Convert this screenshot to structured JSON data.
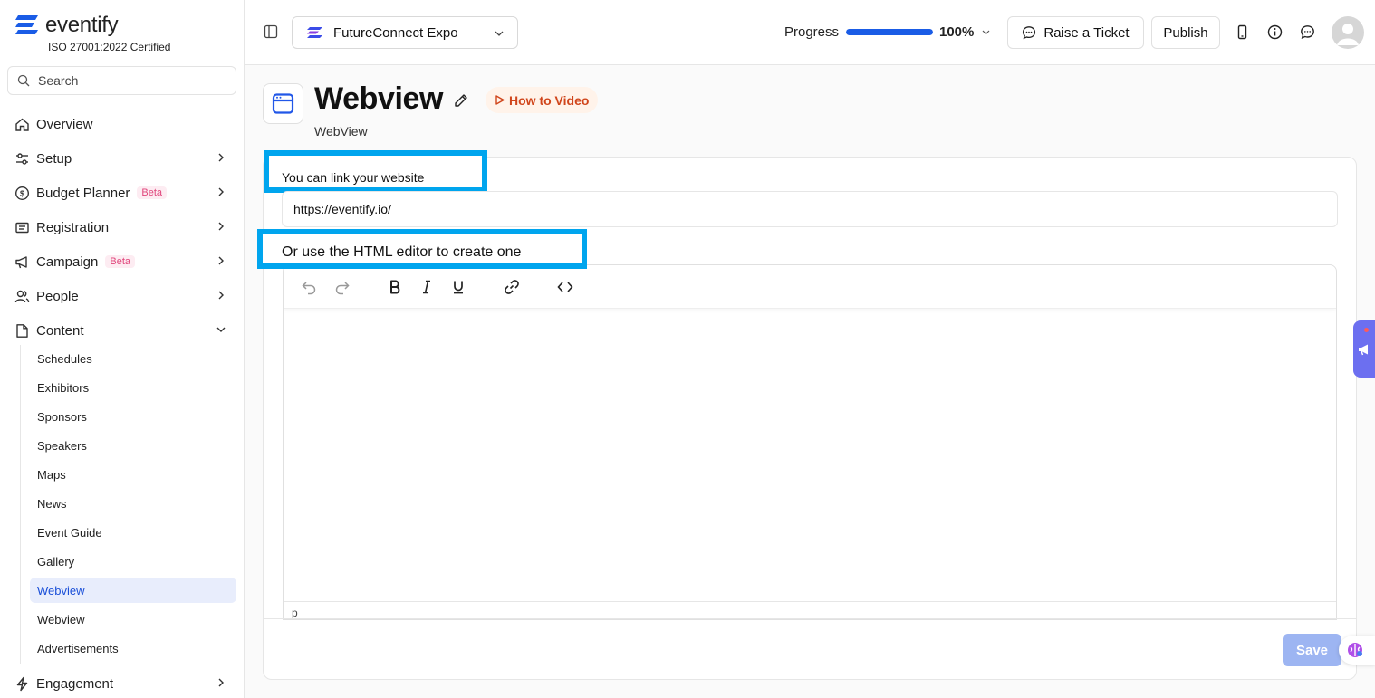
{
  "brand": {
    "name": "eventify",
    "certification": "ISO 27001:2022 Certified"
  },
  "search": {
    "placeholder": "Search"
  },
  "sidebar": {
    "items": [
      {
        "label": "Overview",
        "icon": "home-icon"
      },
      {
        "label": "Setup",
        "icon": "sliders-icon"
      },
      {
        "label": "Budget Planner",
        "icon": "dollar-icon",
        "badge": "Beta"
      },
      {
        "label": "Registration",
        "icon": "registration-icon"
      },
      {
        "label": "Campaign",
        "icon": "megaphone-icon",
        "badge": "Beta"
      },
      {
        "label": "People",
        "icon": "people-icon"
      },
      {
        "label": "Content",
        "icon": "content-icon"
      },
      {
        "label": "Engagement",
        "icon": "bolt-icon"
      }
    ],
    "content_subitems": [
      "Schedules",
      "Exhibitors",
      "Sponsors",
      "Speakers",
      "Maps",
      "News",
      "Event Guide",
      "Gallery",
      "Webview",
      "Webview",
      "Advertisements"
    ],
    "active_subitem": "Webview"
  },
  "topbar": {
    "event_name": "FutureConnect Expo",
    "progress_label": "Progress",
    "progress_value": "100%",
    "progress_fraction": 1.0,
    "ticket_label": "Raise a Ticket",
    "publish_label": "Publish"
  },
  "page": {
    "title": "Webview",
    "how_to_label": "How to Video",
    "subtitle": "WebView",
    "link_label": "You can link your website",
    "url_value": "https://eventify.io/",
    "editor_label": "Or use the HTML editor to create one",
    "editor_status": "p",
    "save_label": "Save"
  },
  "colors": {
    "accent": "#1a5ce6",
    "highlight": "#00a5ee",
    "save_disabled": "#9db5f2",
    "beta": "#e0457b"
  }
}
